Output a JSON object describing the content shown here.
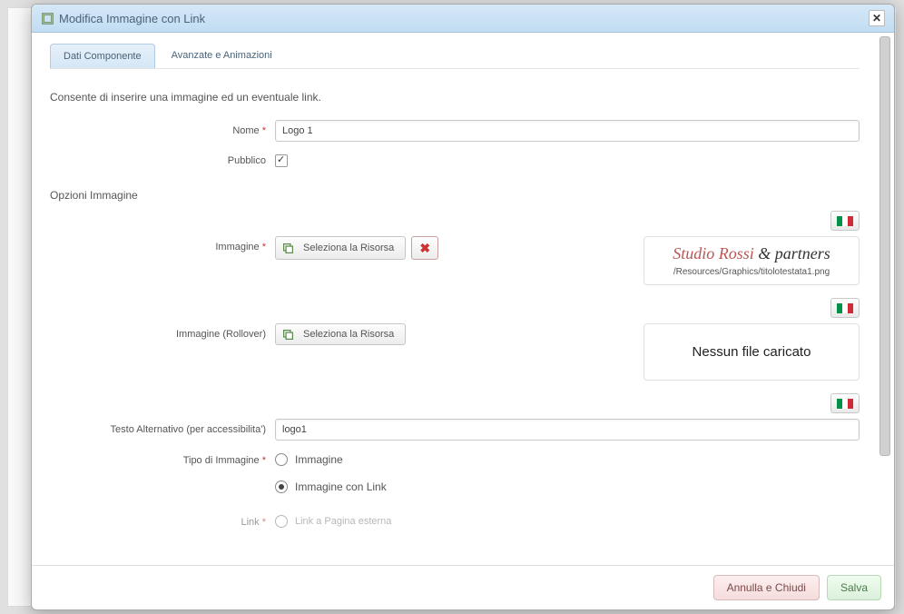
{
  "dialog": {
    "title": "Modifica Immagine con Link"
  },
  "tabs": {
    "tab1": "Dati Componente",
    "tab2": "Avanzate e Animazioni"
  },
  "description": "Consente di inserire una immagine ed un eventuale link.",
  "labels": {
    "nome": "Nome",
    "pubblico": "Pubblico",
    "opzioni_immagine": "Opzioni Immagine",
    "immagine": "Immagine",
    "immagine_rollover": "Immagine (Rollover)",
    "testo_alt": "Testo Alternativo (per accessibilita')",
    "tipo_immagine": "Tipo di Immagine",
    "link": "Link"
  },
  "fields": {
    "nome_value": "Logo 1",
    "pubblico_checked": true,
    "testo_alt_value": "logo1"
  },
  "resource": {
    "select_label": "Seleziona la Risorsa",
    "preview_text_a": "Studio Rossi",
    "preview_text_b": " & ",
    "preview_text_c": "partners",
    "preview_path": "/Resources/Graphics/titolotestata1.png",
    "no_file": "Nessun file caricato"
  },
  "radios": {
    "tipo_opt1": "Immagine",
    "tipo_opt2": "Immagine con Link",
    "link_opt1": "Link a Pagina esterna"
  },
  "footer": {
    "cancel": "Annulla e Chiudi",
    "save": "Salva"
  }
}
